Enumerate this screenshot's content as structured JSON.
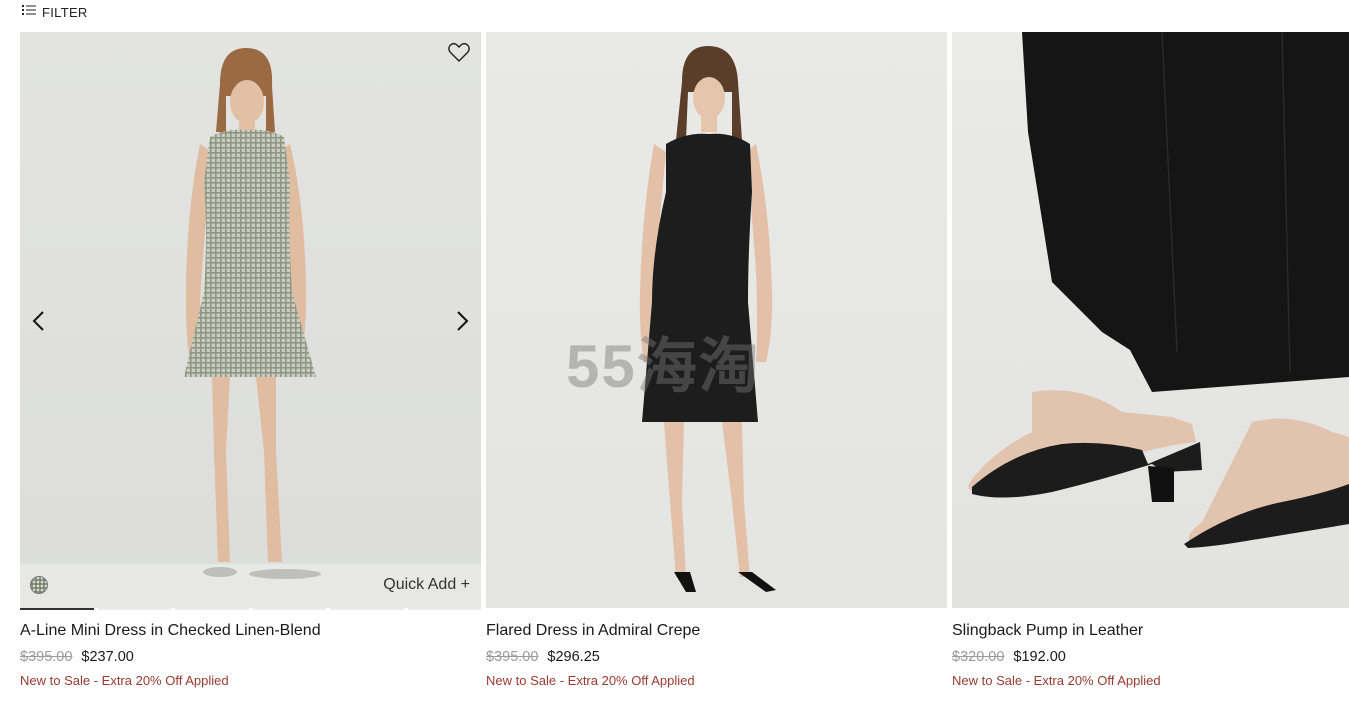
{
  "filter": {
    "label": "FILTER",
    "icon": "filter-list-icon"
  },
  "products": [
    {
      "name": "A-Line Mini Dress in Checked Linen-Blend",
      "original_price": "$395.00",
      "sale_price": "$237.00",
      "promo": "New to Sale - Extra 20% Off Applied",
      "quick_add": "Quick Add +",
      "image": "model in checked linen mini dress"
    },
    {
      "name": "Flared Dress in Admiral Crepe",
      "original_price": "$395.00",
      "sale_price": "$296.25",
      "promo": "New to Sale - Extra 20% Off Applied",
      "image": "model in black flared dress"
    },
    {
      "name": "Slingback Pump in Leather",
      "original_price": "$320.00",
      "sale_price": "$192.00",
      "promo": "New to Sale - Extra 20% Off Applied",
      "image": "black leather slingback pumps"
    }
  ],
  "watermark": "55海淘",
  "colors": {
    "promo": "#9b3a30",
    "strike": "#9a9a9a",
    "text": "#1a1a1a"
  }
}
